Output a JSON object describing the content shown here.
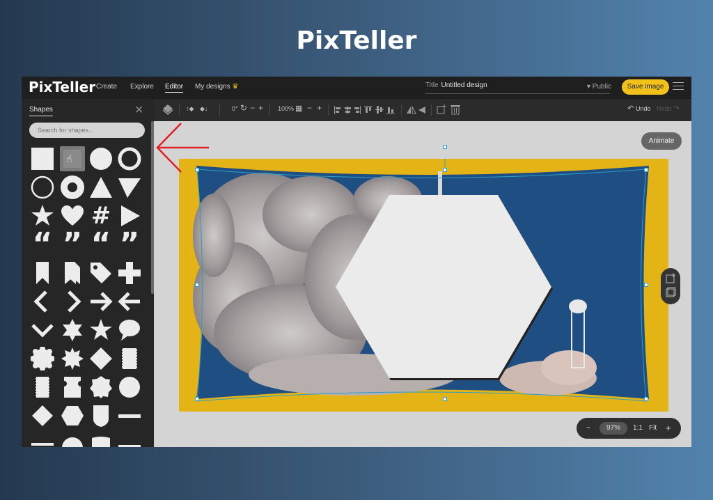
{
  "page": {
    "title": "PixTeller"
  },
  "app": {
    "logo": "PixTeller",
    "nav": [
      "Create",
      "Explore",
      "Editor",
      "My designs"
    ],
    "title_label": "Title",
    "title_value": "Untitled design",
    "visibility": "▾ Public",
    "save_label": "Save image",
    "toolbar": {
      "rotate": "0°",
      "zoom": "100%",
      "undo": "Undo",
      "redo": "Redo"
    },
    "sidebar": {
      "tab": "Shapes",
      "search_placeholder": "Search for shapes..."
    },
    "animate_label": "Animate",
    "zoom_bar": {
      "minus": "−",
      "value": "97%",
      "ratio": "1:1",
      "fit": "Fit",
      "plus": "+"
    }
  },
  "colors": {
    "accent": "#f2c21b",
    "canvas_bg": "#e4b416",
    "arrow": "#e01f26",
    "handle": "#2b9ec9"
  }
}
